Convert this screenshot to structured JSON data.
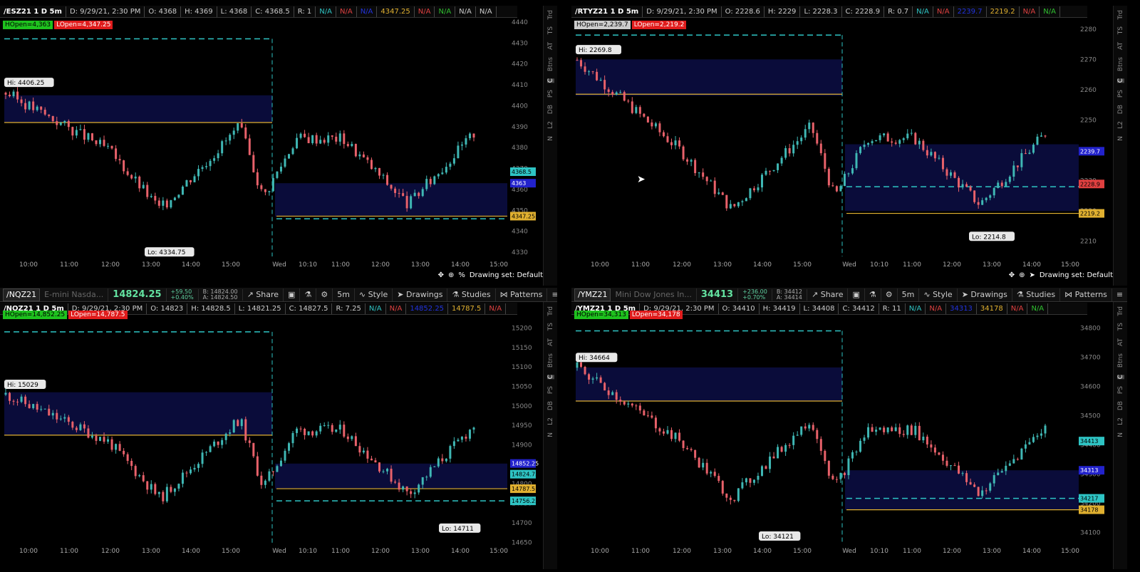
{
  "panes": [
    {
      "id": "es",
      "symbol": "/ESZ21 1 D 5m",
      "date": "D: 9/29/21, 2:30 PM",
      "o": "O: 4368",
      "h": "H: 4369",
      "l": "L: 4368",
      "c": "C: 4368.5",
      "r": "R: 1",
      "extra": [
        "N/A",
        "N/A",
        "N/A",
        "4347.25",
        "N/A",
        "N/A",
        "N/A",
        "N/A"
      ],
      "hopen": "HOpen=4,363",
      "lopen": "LOpen=4,347.25",
      "hi": "Hi: 4406.25",
      "lo": "Lo: 4334.75",
      "yticks": [
        "4440",
        "4430",
        "4420",
        "4410",
        "4400",
        "4390",
        "4380",
        "4370",
        "4360",
        "4350",
        "4340",
        "4330"
      ],
      "xticks": [
        "10:00",
        "11:00",
        "12:00",
        "13:00",
        "14:00",
        "15:00",
        "Wed",
        "10:10",
        "11:00",
        "12:00",
        "13:00",
        "14:00",
        "15:00"
      ],
      "tags": [
        "4368.5",
        "4363",
        "4347.25"
      ],
      "drawing_set": "Drawing set: Default"
    },
    {
      "id": "rty",
      "symbol": "/RTYZ21 1 D 5m",
      "date": "D: 9/29/21, 2:30 PM",
      "o": "O: 2228.6",
      "h": "H: 2229",
      "l": "L: 2228.3",
      "c": "C: 2228.9",
      "r": "R: 0.7",
      "extra": [
        "N/A",
        "N/A",
        "2239.7",
        "2219.2",
        "N/A",
        "N/A"
      ],
      "hopen": "HOpen=2,239.7",
      "lopen": "LOpen=2,219.2",
      "hi": "Hi: 2269.8",
      "lo": "Lo: 2214.8",
      "yticks": [
        "2280",
        "2270",
        "2260",
        "2250",
        "2240",
        "2230",
        "2220",
        "2210"
      ],
      "xticks": [
        "10:00",
        "11:00",
        "12:00",
        "13:00",
        "14:00",
        "15:00",
        "Wed",
        "10:10",
        "11:00",
        "12:00",
        "13:00",
        "14:00",
        "15:00"
      ],
      "tags": [
        "2239.7",
        "2228.9",
        "2219.2"
      ],
      "drawing_set": "Drawing set: Default"
    },
    {
      "id": "nq",
      "symbol": "/NQZ21 1 D 5m",
      "tb_symbol": "/NQZ21",
      "tb_desc": "E-mini Nasda...",
      "tb_price": "14824.25",
      "tb_chg1": "+59.50",
      "tb_chg2": "+0.40%",
      "tb_bid": "B: 14824.00",
      "tb_ask": "A: 14824.50",
      "date": "D: 9/29/21, 2:30 PM",
      "o": "O: 14823",
      "h": "H: 14828.5",
      "l": "L: 14821.25",
      "c": "C: 14827.5",
      "r": "R: 7.25",
      "extra": [
        "N/A",
        "N/A",
        "14852.25",
        "14787.5",
        "N/A"
      ],
      "hopen": "HOpen=14,852.25",
      "lopen": "LOpen=14,787.5",
      "hi": "Hi: 15029",
      "lo": "Lo: 14711",
      "yticks": [
        "15200",
        "15150",
        "15100",
        "15050",
        "15000",
        "14950",
        "14900",
        "14850",
        "14800",
        "14750",
        "14700",
        "14650"
      ],
      "xticks": [
        "10:00",
        "11:00",
        "12:00",
        "13:00",
        "14:00",
        "15:00",
        "Wed",
        "10:10",
        "11:00",
        "12:00",
        "13:00",
        "14:00",
        "15:00"
      ],
      "tags": [
        "14852.25",
        "14824.75",
        "14787.5",
        "14756.25"
      ]
    },
    {
      "id": "ym",
      "symbol": "/YMZ21 1 D 5m",
      "tb_symbol": "/YMZ21",
      "tb_desc": "Mini Dow Jones In...",
      "tb_price": "34413",
      "tb_chg1": "+236.00",
      "tb_chg2": "+0.70%",
      "tb_bid": "B: 34412",
      "tb_ask": "A: 34414",
      "date": "D: 9/29/21, 2:30 PM",
      "o": "O: 34410",
      "h": "H: 34419",
      "l": "L: 34408",
      "c": "C: 34412",
      "r": "R: 11",
      "extra": [
        "N/A",
        "N/A",
        "34313",
        "34178",
        "N/A",
        "N/A"
      ],
      "hopen": "HOpen=34,313",
      "lopen": "LOpen=34,178",
      "hi": "Hi: 34664",
      "lo": "Lo: 34121",
      "yticks": [
        "34800",
        "34700",
        "34600",
        "34500",
        "34400",
        "34300",
        "34200",
        "34100"
      ],
      "xticks": [
        "10:00",
        "11:00",
        "12:00",
        "13:00",
        "14:00",
        "15:00",
        "Wed",
        "10:10",
        "11:00",
        "12:00",
        "13:00",
        "14:00",
        "15:00"
      ],
      "tags": [
        "34413",
        "34313",
        "34217",
        "34178"
      ]
    }
  ],
  "toolbar": {
    "share": "Share",
    "tf": "5m",
    "style": "Style",
    "drawings": "Drawings",
    "studies": "Studies",
    "patterns": "Patterns"
  },
  "sidebar": [
    "Trd",
    "TS",
    "AT",
    "Btns",
    "C",
    "PS",
    "DB",
    "L2",
    "N"
  ],
  "colors": {
    "up": "#3fb7b4",
    "down": "#e8616a",
    "cyan": "#2ec4c4",
    "gold": "#e0b030",
    "range": "#0a0c3a"
  }
}
